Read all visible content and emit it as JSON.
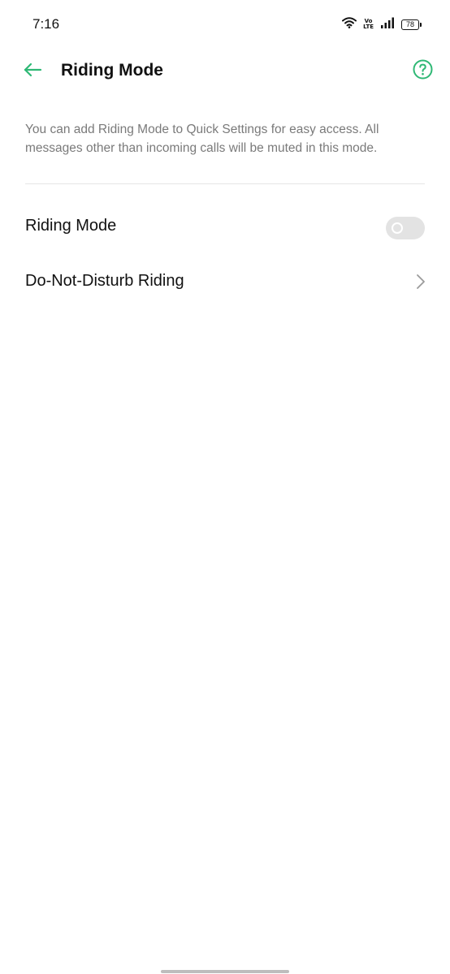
{
  "status_bar": {
    "time": "7:16",
    "volte_top": "Vo",
    "volte_bottom": "LTE",
    "battery": "78",
    "icons": [
      "wifi-icon",
      "volte-icon",
      "signal-icon",
      "battery-icon"
    ]
  },
  "header": {
    "title": "Riding Mode",
    "back_icon": "arrow-left-icon",
    "help_icon": "question-circle-icon"
  },
  "description": "You can add Riding Mode to Quick Settings for easy access. All messages other than incoming calls will be muted in this mode.",
  "settings": {
    "riding_mode": {
      "label": "Riding Mode",
      "enabled": false
    },
    "dnd_riding": {
      "label": "Do-Not-Disturb Riding",
      "icon": "chevron-right-icon"
    }
  },
  "colors": {
    "accent": "#2fb875",
    "description_text": "#7a7a7a",
    "toggle_off": "#e3e3e3",
    "divider": "#e5e5e5"
  }
}
